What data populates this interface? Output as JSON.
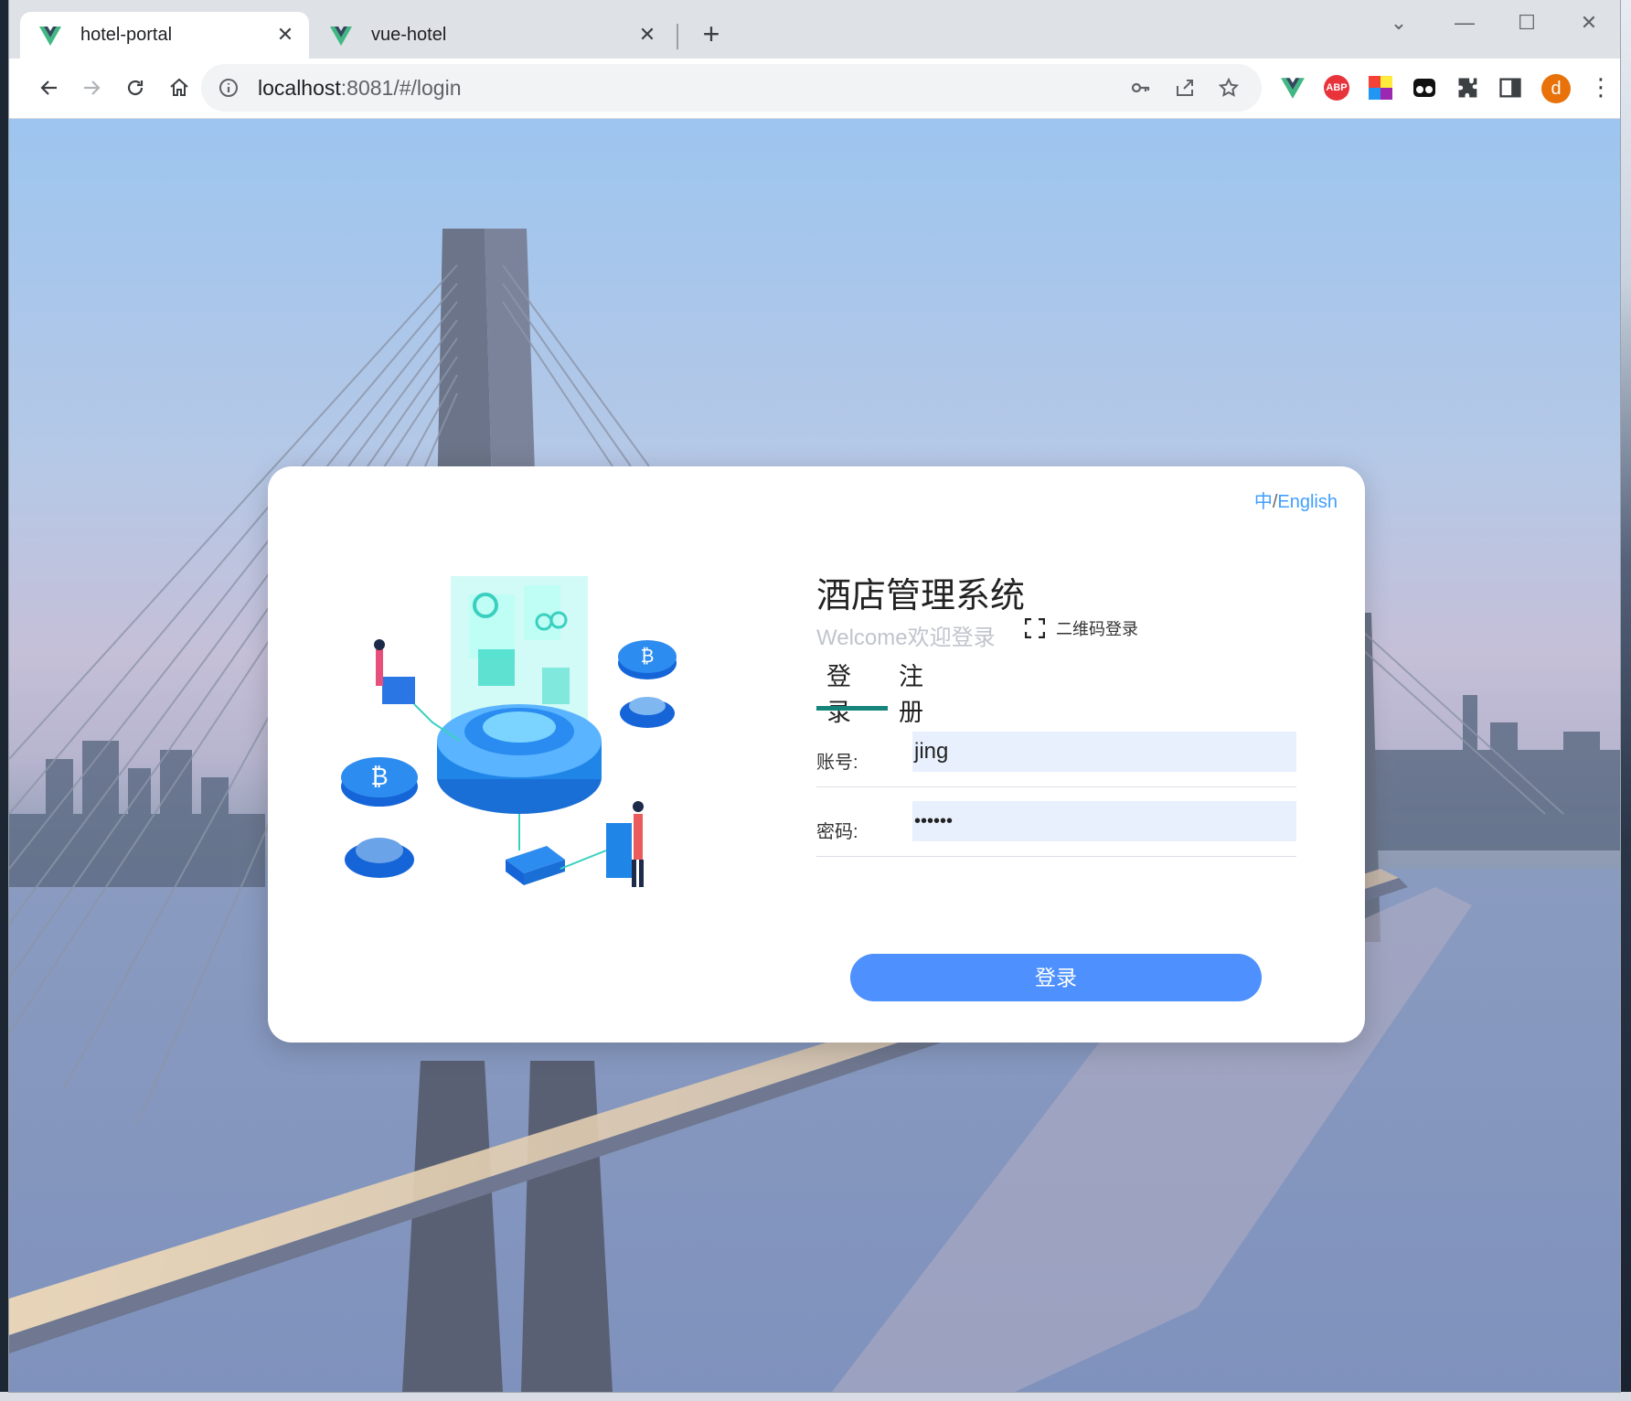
{
  "browser": {
    "tabs": [
      {
        "title": "hotel-portal",
        "active": true
      },
      {
        "title": "vue-hotel",
        "active": false
      }
    ],
    "url_host": "localhost",
    "url_rest": ":8081/#/login",
    "avatar_letter": "d",
    "extensions": [
      "vue-devtools",
      "adblock-plus",
      "color-picker",
      "incognito-ext",
      "puzzle-extensions",
      "side-panel"
    ],
    "extension_labels": {
      "abp": "ABP"
    }
  },
  "login": {
    "lang_zh": "中",
    "lang_sep": "/",
    "lang_en": "English",
    "title": "酒店管理系统",
    "welcome": "Welcome欢迎登录",
    "qr_label": "二维码登录",
    "tab_login": "登录",
    "tab_register": "注册",
    "account_label": "账号:",
    "account_value": "jing",
    "password_label": "密码:",
    "password_value": "••••••",
    "submit_label": "登录"
  },
  "colors": {
    "accent_blue": "#409eff",
    "button_blue": "#4d90fe",
    "tab_underline": "#15847a",
    "input_fill": "#e8f0fe"
  }
}
